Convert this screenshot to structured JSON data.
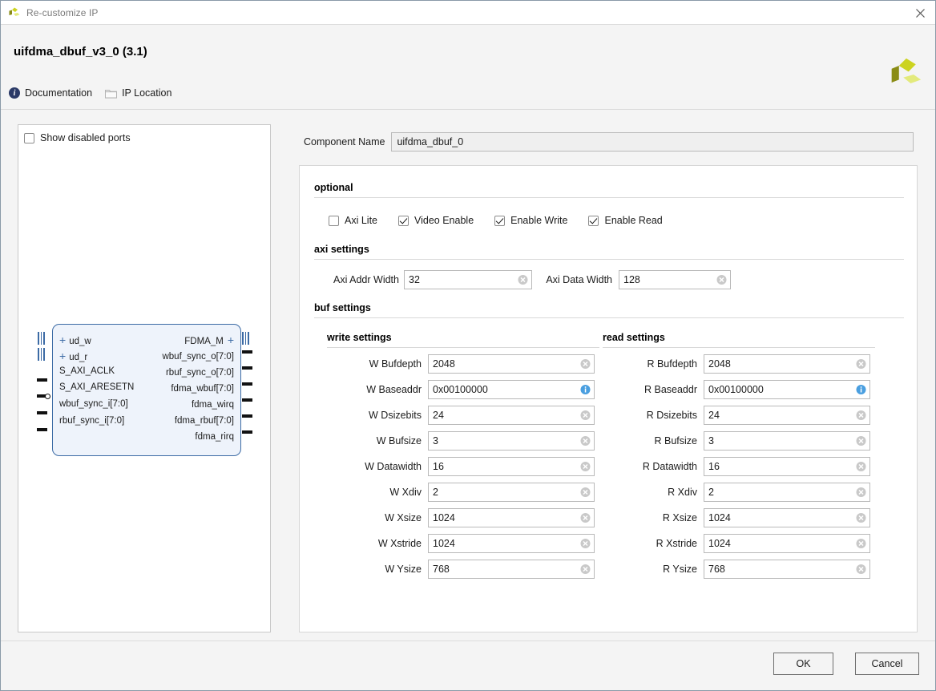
{
  "window": {
    "title": "Re-customize IP",
    "close_icon": "close-icon",
    "logo_icon": "xilinx-logo-icon"
  },
  "header": {
    "ip_title": "uifdma_dbuf_v3_0 (3.1)",
    "links": [
      {
        "label": "Documentation",
        "icon": "info-icon"
      },
      {
        "label": "IP Location",
        "icon": "folder-icon"
      }
    ]
  },
  "ports_panel": {
    "show_disabled_label": "Show disabled ports",
    "show_disabled_checked": false,
    "block": {
      "left_ports": [
        {
          "name": "ud_w",
          "type": "bus",
          "expander": "+"
        },
        {
          "name": "ud_r",
          "type": "bus",
          "expander": "+"
        },
        {
          "name": "S_AXI_ACLK",
          "type": "pin"
        },
        {
          "name": "S_AXI_ARESETN",
          "type": "pin-inverted"
        },
        {
          "name": "wbuf_sync_i[7:0]",
          "type": "pin"
        },
        {
          "name": "rbuf_sync_i[7:0]",
          "type": "pin"
        }
      ],
      "right_ports": [
        {
          "name": "FDMA_M",
          "type": "bus",
          "expander": "+"
        },
        {
          "name": "wbuf_sync_o[7:0]",
          "type": "pin"
        },
        {
          "name": "rbuf_sync_o[7:0]",
          "type": "pin"
        },
        {
          "name": "fdma_wbuf[7:0]",
          "type": "pin"
        },
        {
          "name": "fdma_wirq",
          "type": "pin"
        },
        {
          "name": "fdma_rbuf[7:0]",
          "type": "pin"
        },
        {
          "name": "fdma_rirq",
          "type": "pin"
        }
      ]
    }
  },
  "component": {
    "label": "Component Name",
    "value": "uifdma_dbuf_0"
  },
  "optional": {
    "title": "optional",
    "checkboxes": [
      {
        "label": "Axi Lite",
        "checked": false
      },
      {
        "label": "Video Enable",
        "checked": true
      },
      {
        "label": "Enable Write",
        "checked": true
      },
      {
        "label": "Enable Read",
        "checked": true
      }
    ]
  },
  "axi_settings": {
    "title": "axi settings",
    "fields": [
      {
        "label": "Axi Addr Width",
        "value": "32",
        "button": "clear-icon"
      },
      {
        "label": "Axi Data Width",
        "value": "128",
        "button": "clear-icon"
      }
    ]
  },
  "buf_settings": {
    "title": "buf settings",
    "write": {
      "title": "write settings",
      "fields": [
        {
          "label": "W Bufdepth",
          "value": "2048",
          "button": "clear-icon"
        },
        {
          "label": "W Baseaddr",
          "value": "0x00100000",
          "button": "info-icon"
        },
        {
          "label": "W Dsizebits",
          "value": "24",
          "button": "clear-icon"
        },
        {
          "label": "W Bufsize",
          "value": "3",
          "button": "clear-icon"
        },
        {
          "label": "W Datawidth",
          "value": "16",
          "button": "clear-icon"
        },
        {
          "label": "W Xdiv",
          "value": "2",
          "button": "clear-icon"
        },
        {
          "label": "W Xsize",
          "value": "1024",
          "button": "clear-icon"
        },
        {
          "label": "W Xstride",
          "value": "1024",
          "button": "clear-icon"
        },
        {
          "label": "W Ysize",
          "value": "768",
          "button": "clear-icon"
        }
      ]
    },
    "read": {
      "title": "read settings",
      "fields": [
        {
          "label": "R Bufdepth",
          "value": "2048",
          "button": "clear-icon"
        },
        {
          "label": "R Baseaddr",
          "value": "0x00100000",
          "button": "info-icon"
        },
        {
          "label": "R Dsizebits",
          "value": "24",
          "button": "clear-icon"
        },
        {
          "label": "R Bufsize",
          "value": "3",
          "button": "clear-icon"
        },
        {
          "label": "R Datawidth",
          "value": "16",
          "button": "clear-icon"
        },
        {
          "label": "R Xdiv",
          "value": "2",
          "button": "clear-icon"
        },
        {
          "label": "R Xsize",
          "value": "1024",
          "button": "clear-icon"
        },
        {
          "label": "R Xstride",
          "value": "1024",
          "button": "clear-icon"
        },
        {
          "label": "R Ysize",
          "value": "768",
          "button": "clear-icon"
        }
      ]
    }
  },
  "footer": {
    "ok_label": "OK",
    "cancel_label": "Cancel"
  },
  "colors": {
    "accent_blue": "#3c6ba5",
    "block_fill": "#eef3fb",
    "logo_dark": "#8a8c15",
    "logo_mid": "#ccd320",
    "logo_light": "#e3ea7c",
    "info_blue": "#4a9fe0",
    "page_bg": "#f4f4f4"
  }
}
